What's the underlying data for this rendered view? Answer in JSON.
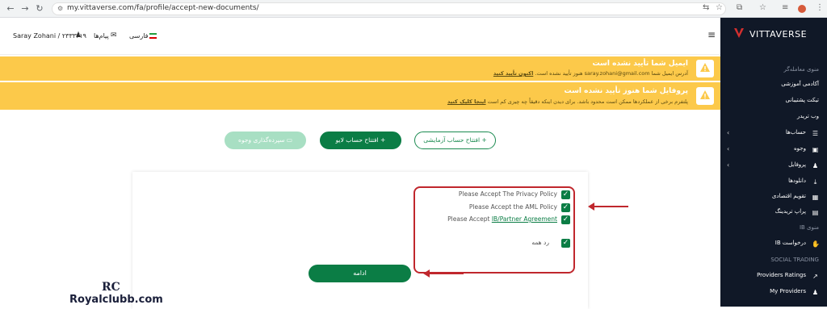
{
  "browser": {
    "url": "my.vittaverse.com/fa/profile/accept-new-documents/"
  },
  "topbar": {
    "user_name": "Saray Zohani / ۲۳۳۳۲۱۹",
    "messages": "پیام‌ها",
    "language": "فارسی"
  },
  "alerts": [
    {
      "title": "ایمیل شما تأیید نشده است",
      "body": "آدرس ایمیل شما saray.zohani@gmail.com هنوز تأیید نشده است.",
      "link": "اکنون تأیید کنید"
    },
    {
      "title": "پروفایل شما هنوز تأیید نشده است",
      "body": "پلتفرم برخی از عملکردها ممکن است محدود باشد. برای دیدن اینکه دقیقاً چه چیزی کم است",
      "link": "اینجا کلیک کنید"
    }
  ],
  "actions": {
    "demo": "افتتاح حساب آزمایشی",
    "live": "افتتاح حساب لایو",
    "deposit": "سپرده‌گذاری وجوه"
  },
  "consents": {
    "privacy": "Please Accept The Privacy Policy",
    "aml": "Please Accept the AML Policy",
    "ib_prefix": "Please Accept ",
    "ib_link": "IB/Partner Agreement",
    "reject_all": "رد همه"
  },
  "continue_label": "ادامه",
  "watermark": {
    "logo": "RC",
    "text": "Royalclubb.com"
  },
  "sidebar": {
    "brand": "VITTAVERSE",
    "section_trading": "منوی معامله‌گر",
    "items_top": [
      "آکادمی آموزشی",
      "تیکت پشتیبانی",
      "وب تریدر"
    ],
    "items_main": [
      "حساب‌ها",
      "وجوه",
      "پروفایل",
      "دانلودها",
      "تقویم اقتصادی",
      "پراپ تریدینگ"
    ],
    "section_ib": "منوی IB",
    "ib_item": "درخواست IB",
    "section_social": "SOCIAL TRADING",
    "social_items": [
      "Providers Ratings",
      "My Providers"
    ]
  },
  "colors": {
    "accent": "#0b7d45",
    "alert": "#fcc94a",
    "sidebar": "#101827",
    "annotation": "#c0272d"
  }
}
